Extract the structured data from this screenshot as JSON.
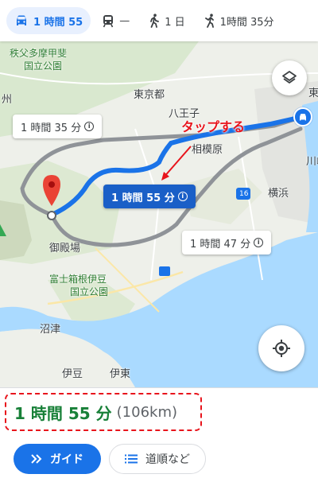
{
  "travel_modes": [
    {
      "name": "car",
      "label": "1 時間 55",
      "active": true
    },
    {
      "name": "transit",
      "label": "—",
      "active": false
    },
    {
      "name": "walk",
      "label": "1 日",
      "active": false
    },
    {
      "name": "ride",
      "label": "1時間 35分",
      "active": false
    }
  ],
  "map": {
    "places": {
      "chichibu": "秩父多摩甲斐",
      "chichibu_park": "国立公園",
      "tokyo_metro": "東京都",
      "hachioji": "八王子",
      "sagamihara": "相模原",
      "kawasaki": "川崎",
      "yokohama": "横浜",
      "gotemba": "御殿場",
      "fuji_hakone": "富士箱根伊豆",
      "fuji_park": "国立公園",
      "numazu": "沼津",
      "izu": "伊豆",
      "ito": "伊東",
      "to_edge": "東",
      "shu_edge": "州"
    },
    "route_badge": "16",
    "routes": {
      "alt1": "1 時間 35 分",
      "selected": "1 時間 55 分",
      "alt2": "1 時間 47 分"
    },
    "info_glyph": "i",
    "annotation": "タップする",
    "colors": {
      "selected_route": "#1a73e8",
      "alt_route": "#9aa0a6",
      "annotation": "#e8141c",
      "marker": "#ea4335",
      "water": "#aadaff"
    }
  },
  "sheet": {
    "duration": "1 時間 55 分",
    "distance": "(106km)",
    "guide_label": "ガイド",
    "steps_label": "道順など"
  }
}
